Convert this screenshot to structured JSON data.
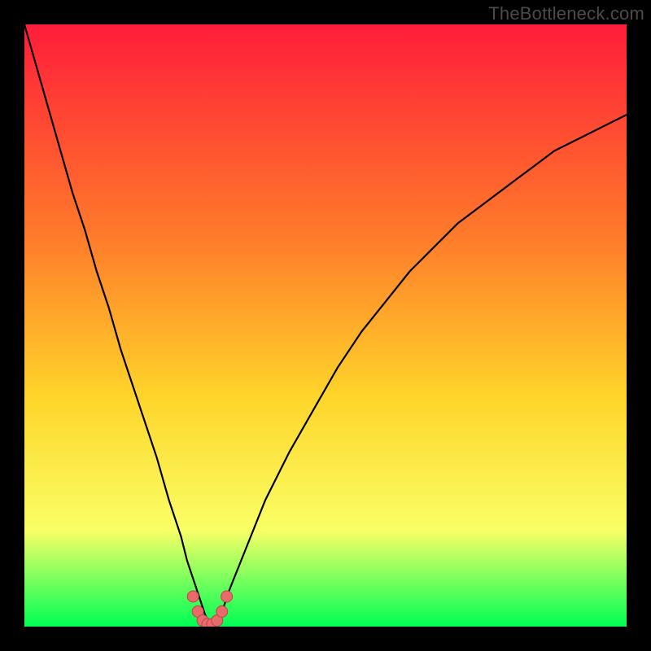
{
  "watermark": "TheBottleneck.com",
  "colors": {
    "gradient_top": "#ff1d3a",
    "gradient_mid1": "#ff7a2a",
    "gradient_mid2": "#ffd52a",
    "gradient_mid3": "#f9ff66",
    "gradient_bottom": "#00ff55",
    "curve": "#000000",
    "marker_fill": "#e86a6a",
    "marker_stroke": "#b74848"
  },
  "chart_data": {
    "type": "line",
    "title": "",
    "xlabel": "",
    "ylabel": "",
    "xlim": [
      0,
      100
    ],
    "ylim": [
      0,
      100
    ],
    "series": [
      {
        "name": "bottleneck-curve",
        "x": [
          0,
          2,
          4,
          6,
          8,
          10,
          12,
          14,
          16,
          18,
          20,
          22,
          24,
          25,
          26,
          27,
          28,
          29,
          30,
          31,
          32,
          33,
          34,
          36,
          38,
          40,
          44,
          48,
          52,
          56,
          60,
          64,
          68,
          72,
          76,
          80,
          84,
          88,
          92,
          96,
          100
        ],
        "y": [
          100,
          93,
          86,
          79,
          72,
          66,
          59,
          53,
          46,
          40,
          34,
          28,
          21,
          18,
          15,
          11,
          8,
          5,
          2,
          0,
          1,
          3,
          6,
          11,
          16,
          21,
          29,
          36,
          43,
          49,
          54,
          59,
          63,
          67,
          70,
          73,
          76,
          79,
          81,
          83,
          85
        ]
      }
    ],
    "markers": {
      "name": "highlight-points",
      "x": [
        28.0,
        28.8,
        29.6,
        30.4,
        31.2,
        32.0,
        32.8,
        33.6
      ],
      "y": [
        5.0,
        2.5,
        1.0,
        0.4,
        0.4,
        1.0,
        2.5,
        5.0
      ]
    }
  }
}
